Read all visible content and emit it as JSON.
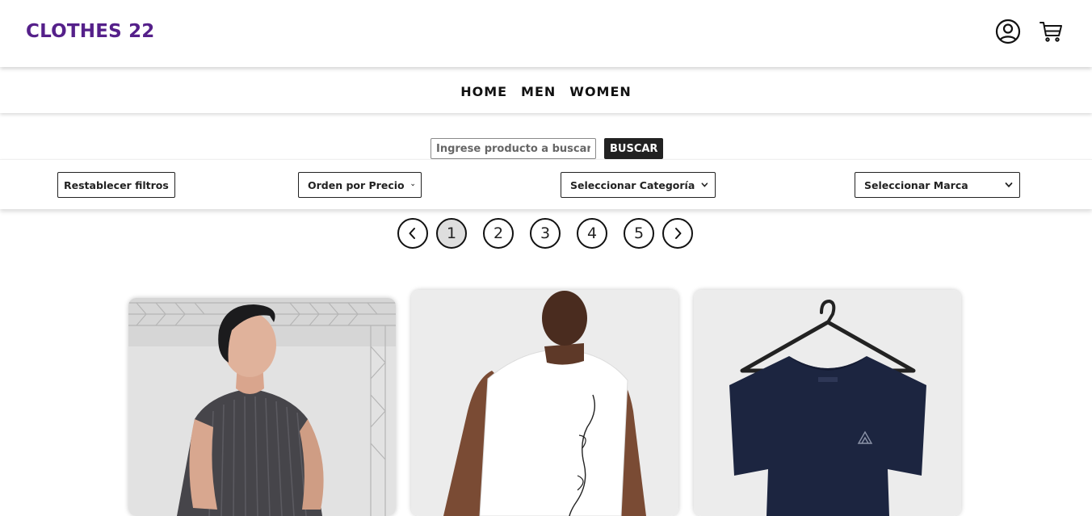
{
  "header": {
    "brand": "CLOTHES 22",
    "brand_color": "#55208a",
    "icons": [
      "user-account-icon",
      "shopping-cart-icon"
    ]
  },
  "nav": {
    "links": [
      "HOME",
      "MEN",
      "WOMEN"
    ]
  },
  "search": {
    "placeholder": "Ingrese producto a buscar",
    "button_label": "BUSCAR"
  },
  "filters": {
    "reset_label": "Restablecer filtros",
    "price_sort": {
      "selected": "Orden por Precio"
    },
    "category": {
      "selected": "Seleccionar Categoría"
    },
    "brand": {
      "selected": "Seleccionar Marca"
    }
  },
  "pagination": {
    "pages": [
      "1",
      "2",
      "3",
      "4",
      "5"
    ],
    "current": "1"
  },
  "products": [
    {
      "image": "man-grey-ribbed-tshirt-photo"
    },
    {
      "image": "man-white-sleeveless-tshirt-back-photo"
    },
    {
      "image": "navy-tshirt-on-hanger-photo"
    }
  ]
}
